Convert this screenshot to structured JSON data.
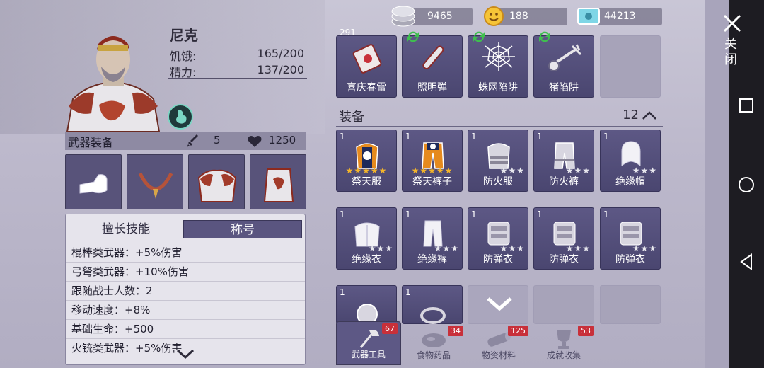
{
  "character": {
    "name": "尼克",
    "hunger_label": "饥饿:",
    "hunger_value": "165/200",
    "energy_label": "精力:",
    "energy_value": "137/200"
  },
  "weapon_bar": {
    "title": "武器装备",
    "attack": "5",
    "health": "1250"
  },
  "skills": {
    "tab_skills": "擅长技能",
    "tab_title": "称号",
    "items": [
      "棍棒类武器：+5%伤害",
      "弓弩类武器：+10%伤害",
      "跟随战士人数：2",
      "移动速度：+8%",
      "基础生命：+500",
      "火铳类武器：+5%伤害"
    ]
  },
  "currency": {
    "coins": "9465",
    "gold": "188",
    "tickets": "44213"
  },
  "top_items": [
    {
      "qty": "291",
      "name": "喜庆春雷"
    },
    {
      "qty": "",
      "name": "照明弹"
    },
    {
      "qty": "",
      "name": "蛛网陷阱"
    },
    {
      "qty": "",
      "name": "猪陷阱"
    }
  ],
  "equipment": {
    "header": "装备",
    "count": "12",
    "items": [
      {
        "qty": "1",
        "name": "祭天服",
        "stars": 5,
        "gold": true
      },
      {
        "qty": "1",
        "name": "祭天裤子",
        "stars": 5,
        "gold": true
      },
      {
        "qty": "1",
        "name": "防火服",
        "stars": 3,
        "gold": false
      },
      {
        "qty": "1",
        "name": "防火裤",
        "stars": 3,
        "gold": false
      },
      {
        "qty": "1",
        "name": "绝缘帽",
        "stars": 3,
        "gold": false
      },
      {
        "qty": "1",
        "name": "绝缘衣",
        "stars": 3,
        "gold": false
      },
      {
        "qty": "1",
        "name": "绝缘裤",
        "stars": 3,
        "gold": false
      },
      {
        "qty": "1",
        "name": "防弹衣",
        "stars": 3,
        "gold": false
      },
      {
        "qty": "1",
        "name": "防弹衣",
        "stars": 3,
        "gold": false
      },
      {
        "qty": "1",
        "name": "防弹衣",
        "stars": 3,
        "gold": false
      },
      {
        "qty": "1",
        "name": "",
        "stars": 0,
        "gold": false
      },
      {
        "qty": "1",
        "name": "",
        "stars": 0,
        "gold": false
      }
    ]
  },
  "bottom_tabs": [
    {
      "label": "武器工具",
      "badge": "67"
    },
    {
      "label": "食物药品",
      "badge": "34"
    },
    {
      "label": "物资材料",
      "badge": "125"
    },
    {
      "label": "成就收集",
      "badge": "53"
    }
  ],
  "close_label": "关闭",
  "colors": {
    "panel_purple": "#5d5885",
    "gold_star": "#f4b52a",
    "badge_red": "#c8303a"
  }
}
